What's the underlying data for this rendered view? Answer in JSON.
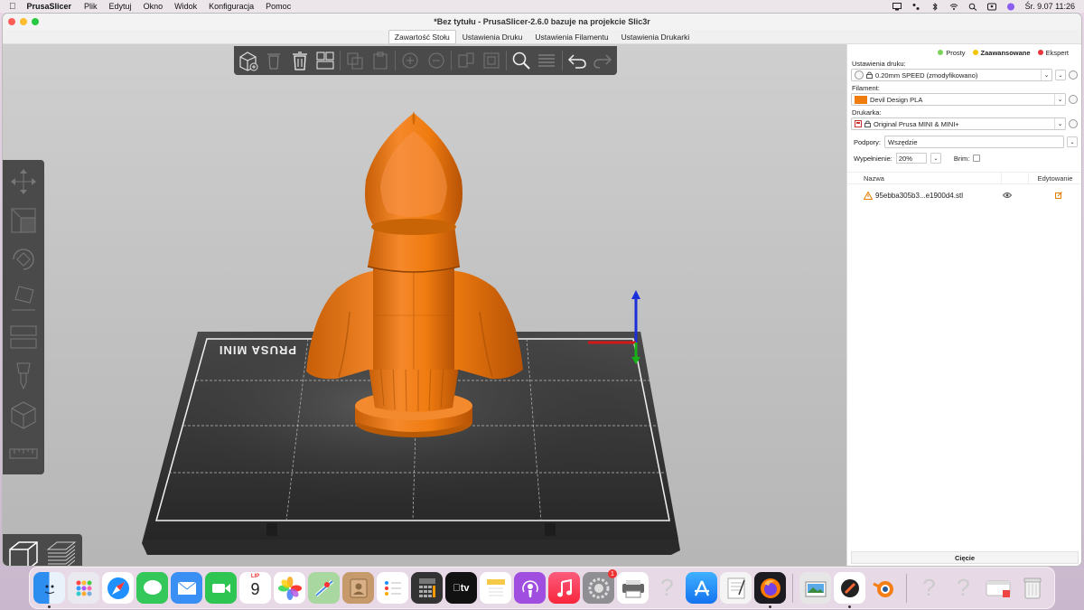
{
  "menubar": {
    "app_name": "PrusaSlicer",
    "items": [
      "Plik",
      "Edytuj",
      "Okno",
      "Widok",
      "Konfiguracja",
      "Pomoc"
    ],
    "datetime": "Śr. 9.07  11:26"
  },
  "window": {
    "title": "*Bez tytułu - PrusaSlicer-2.6.0 bazuje na projekcie Slic3r"
  },
  "tabs": [
    "Zawartość Stołu",
    "Ustawienia Druku",
    "Ustawienia Filamentu",
    "Ustawienia Drukarki"
  ],
  "viewport": {
    "bed_label": "PRUSA MINI",
    "model_color": "#f07c10"
  },
  "sidebar": {
    "modes": [
      {
        "label": "Prosty",
        "color": "#7bd35a"
      },
      {
        "label": "Zaawansowane",
        "color": "#f5c400"
      },
      {
        "label": "Ekspert",
        "color": "#e8343a"
      }
    ],
    "print_settings_label": "Ustawienia druku:",
    "print_settings_value": "0.20mm SPEED (zmodyfikowano)",
    "filament_label": "Filament:",
    "filament_value": "Devil Design PLA",
    "filament_color": "#f07c10",
    "printer_label": "Drukarka:",
    "printer_value": "Original Prusa MINI & MINI+",
    "supports_label": "Podpory:",
    "supports_value": "Wszędzie",
    "infill_label": "Wypełnienie:",
    "infill_value": "20%",
    "brim_label": "Brim:",
    "objects_header_name": "Nazwa",
    "objects_header_edit": "Edytowanie",
    "objects": [
      {
        "name": "95ebba305b3...e1900d4.stl"
      }
    ],
    "slice_button": "Cięcie"
  },
  "dock": {
    "calendar_month": "LIP",
    "calendar_day": "9",
    "settings_badge": "1"
  }
}
